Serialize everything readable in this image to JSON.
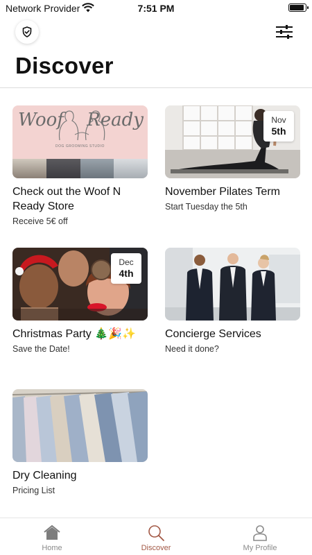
{
  "status_bar": {
    "carrier": "Network Provider",
    "time": "7:51 PM",
    "battery_percent": 100
  },
  "header": {
    "title": "Discover",
    "left_icon": "shield-check-icon",
    "right_icon": "sliders-icon"
  },
  "cards": [
    {
      "title": "Check out the Woof N Ready Store",
      "subtitle": "Receive 5€ off",
      "image_text": [
        "Woof",
        "Ready"
      ],
      "image_subtext": "DOG GROOMING STUDIO"
    },
    {
      "title": "November Pilates Term",
      "subtitle": "Start Tuesday the 5th",
      "badge": {
        "month": "Nov",
        "day": "5th"
      }
    },
    {
      "title": "Christmas Party 🎄🎉✨",
      "subtitle": "Save the Date!",
      "badge": {
        "month": "Dec",
        "day": "4th"
      }
    },
    {
      "title": "Concierge Services",
      "subtitle": "Need it done?"
    },
    {
      "title": "Dry Cleaning",
      "subtitle": "Pricing List"
    }
  ],
  "tabs": [
    {
      "label": "Home",
      "icon": "home-icon",
      "active": false
    },
    {
      "label": "Discover",
      "icon": "search-icon",
      "active": true
    },
    {
      "label": "My Profile",
      "icon": "person-icon",
      "active": false
    }
  ],
  "colors": {
    "accent": "#a25845",
    "inactive_tab": "#8a8a8a"
  }
}
